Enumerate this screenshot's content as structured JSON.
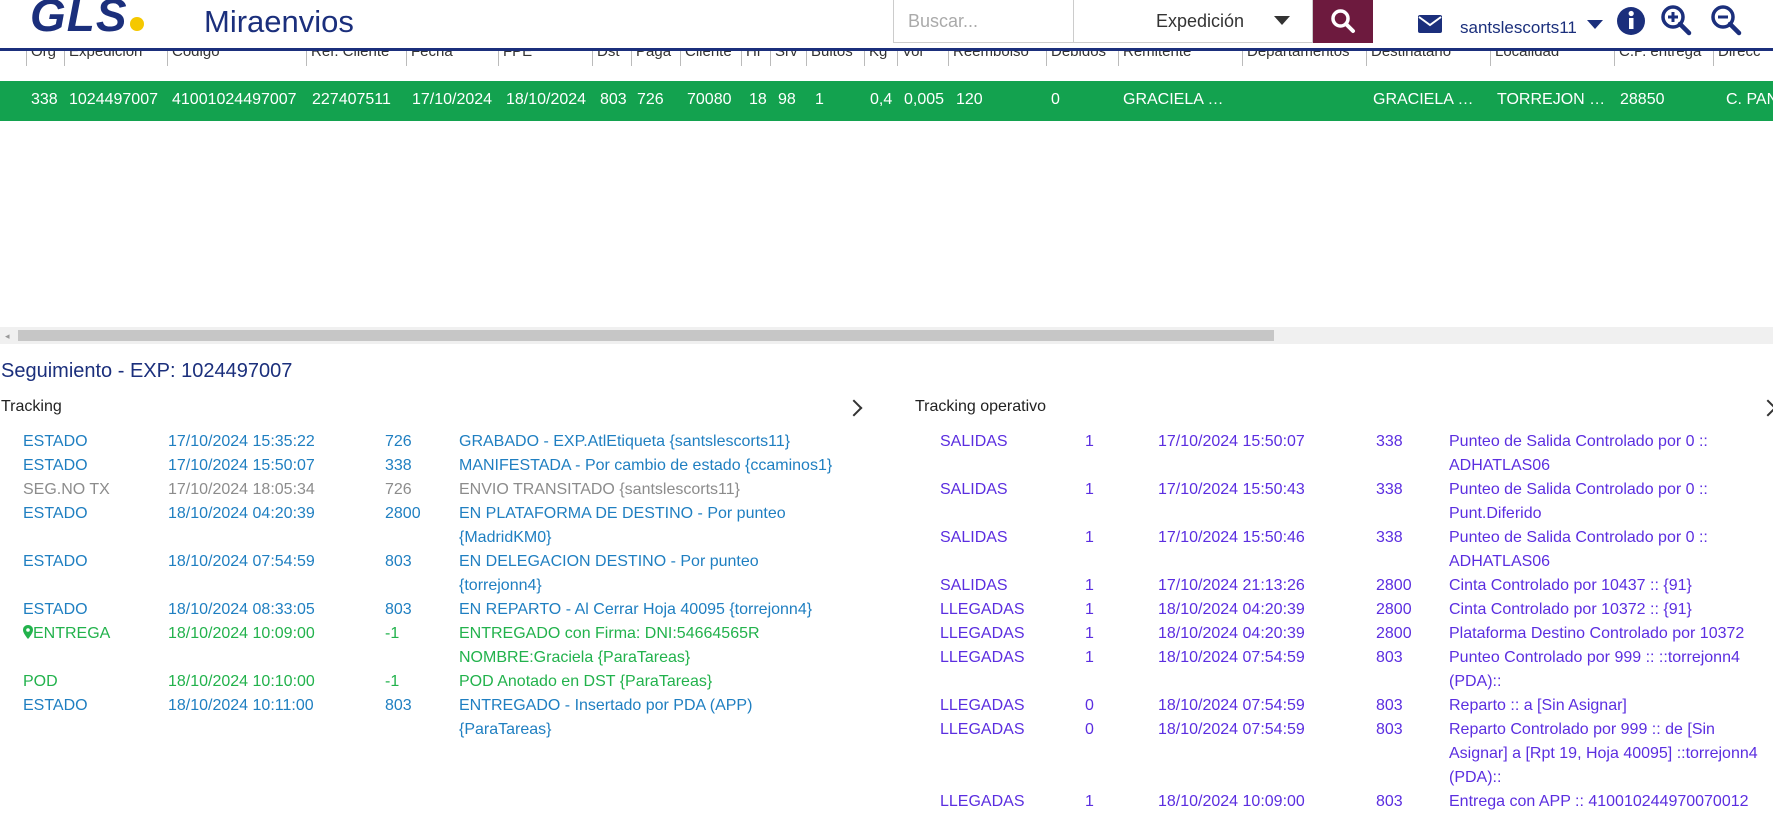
{
  "header": {
    "logo_text": "GLS",
    "app_title": "Miraenvios",
    "search_placeholder": "Buscar...",
    "search_type": "Expedición",
    "user": "santslescorts11"
  },
  "grid": {
    "columns": [
      "Org",
      "Expedición",
      "Código",
      "Ref. Cliente",
      "Fecha",
      "FPE",
      "Dst",
      "Paga",
      "Cliente",
      "Hr",
      "Srv",
      "Bultos",
      "Kg",
      "Vol",
      "Reembolso",
      "Debidos",
      "Remitente",
      "Departamentos",
      "Destinatario",
      "Localidad",
      "C.P. entrega",
      "Direcc"
    ],
    "row": [
      "338",
      "1024497007",
      "41001024497007",
      "227407511",
      "17/10/2024",
      "18/10/2024",
      "803",
      "726",
      "70080",
      "18",
      "98",
      "1",
      "0,4",
      "0,005",
      "120",
      "0",
      "GRACIELA …",
      "",
      "GRACIELA …",
      "TORREJON …",
      "28850",
      "C. PAN"
    ]
  },
  "tracking": {
    "title": "Seguimiento - EXP: 1024497007",
    "tracking_label": "Tracking",
    "operativo_label": "Tracking operativo",
    "events": [
      {
        "estado": "ESTADO",
        "fecha": "17/10/2024 15:35:22",
        "cod": "726",
        "l1": "GRABADO - EXP.AtlEtiqueta {santslescorts11}",
        "l2": "",
        "color": "blue"
      },
      {
        "estado": "ESTADO",
        "fecha": "17/10/2024 15:50:07",
        "cod": "338",
        "l1": "MANIFESTADA - Por cambio de estado {ccaminos1}",
        "l2": "",
        "color": "blue"
      },
      {
        "estado": "SEG.NO TX",
        "fecha": "17/10/2024 18:05:34",
        "cod": "726",
        "l1": "ENVIO TRANSITADO {santslescorts11}",
        "l2": "",
        "color": "gray"
      },
      {
        "estado": "ESTADO",
        "fecha": "18/10/2024 04:20:39",
        "cod": "2800",
        "l1": "EN PLATAFORMA DE DESTINO - Por punteo",
        "l2": "{MadridKM0}",
        "color": "blue"
      },
      {
        "estado": "ESTADO",
        "fecha": "18/10/2024 07:54:59",
        "cod": "803",
        "l1": "EN DELEGACION DESTINO - Por punteo",
        "l2": "{torrejonn4}",
        "color": "blue"
      },
      {
        "estado": "ESTADO",
        "fecha": "18/10/2024 08:33:05",
        "cod": "803",
        "l1": "EN REPARTO - Al Cerrar Hoja 40095 {torrejonn4}",
        "l2": "",
        "color": "blue"
      },
      {
        "estado": "ENTREGA",
        "fecha": "18/10/2024 10:09:00",
        "cod": "-1",
        "l1": "ENTREGADO con Firma: DNI:54664565R",
        "l2": "NOMBRE:Graciela {ParaTareas}",
        "color": "green"
      },
      {
        "estado": "POD",
        "fecha": "18/10/2024 10:10:00",
        "cod": "-1",
        "l1": "POD Anotado en DST {ParaTareas}",
        "l2": "",
        "color": "green"
      },
      {
        "estado": "ESTADO",
        "fecha": "18/10/2024 10:11:00",
        "cod": "803",
        "l1": "ENTREGADO - Insertado por PDA (APP)",
        "l2": "{ParaTareas}",
        "color": "blue"
      }
    ],
    "operativo": [
      {
        "tipo": "SALIDAS",
        "n": "1",
        "fecha": "17/10/2024 15:50:07",
        "cod": "338",
        "l1": "Punteo de Salida Controlado por 0 ::",
        "l2": "ADHATLAS06",
        "l3": ""
      },
      {
        "tipo": "SALIDAS",
        "n": "1",
        "fecha": "17/10/2024 15:50:43",
        "cod": "338",
        "l1": "Punteo de Salida Controlado por 0 ::",
        "l2": "Punt.Diferido",
        "l3": ""
      },
      {
        "tipo": "SALIDAS",
        "n": "1",
        "fecha": "17/10/2024 15:50:46",
        "cod": "338",
        "l1": "Punteo de Salida Controlado por 0 ::",
        "l2": "ADHATLAS06",
        "l3": ""
      },
      {
        "tipo": "SALIDAS",
        "n": "1",
        "fecha": "17/10/2024 21:13:26",
        "cod": "2800",
        "l1": "Cinta Controlado por 10437 :: {91}",
        "l2": "",
        "l3": ""
      },
      {
        "tipo": "LLEGADAS",
        "n": "1",
        "fecha": "18/10/2024 04:20:39",
        "cod": "2800",
        "l1": "Cinta Controlado por 10372 :: {91}",
        "l2": "",
        "l3": ""
      },
      {
        "tipo": "LLEGADAS",
        "n": "1",
        "fecha": "18/10/2024 04:20:39",
        "cod": "2800",
        "l1": "Plataforma Destino Controlado por 10372",
        "l2": "",
        "l3": ""
      },
      {
        "tipo": "LLEGADAS",
        "n": "1",
        "fecha": "18/10/2024 07:54:59",
        "cod": "803",
        "l1": "Punteo Controlado por 999 :: ::torrejonn4",
        "l2": "(PDA)::",
        "l3": ""
      },
      {
        "tipo": "LLEGADAS",
        "n": "0",
        "fecha": "18/10/2024 07:54:59",
        "cod": "803",
        "l1": "Reparto :: a [Sin Asignar]",
        "l2": "",
        "l3": ""
      },
      {
        "tipo": "LLEGADAS",
        "n": "0",
        "fecha": "18/10/2024 07:54:59",
        "cod": "803",
        "l1": "Reparto Controlado por 999 :: de [Sin",
        "l2": "Asignar] a [Rpt 19, Hoja 40095] ::torrejonn4",
        "l3": "(PDA)::"
      },
      {
        "tipo": "LLEGADAS",
        "n": "1",
        "fecha": "18/10/2024 10:09:00",
        "cod": "803",
        "l1": "Entrega con APP :: 410010244970070012",
        "l2": "",
        "l3": ""
      }
    ]
  },
  "colors": {
    "brand": "#1b2f7c",
    "row_green": "#13a24f",
    "search_btn": "#6d1a3e",
    "estado_blue": "#1f7fc1",
    "entrega_green": "#22b24c",
    "operativo_purple": "#5b2ee0"
  }
}
